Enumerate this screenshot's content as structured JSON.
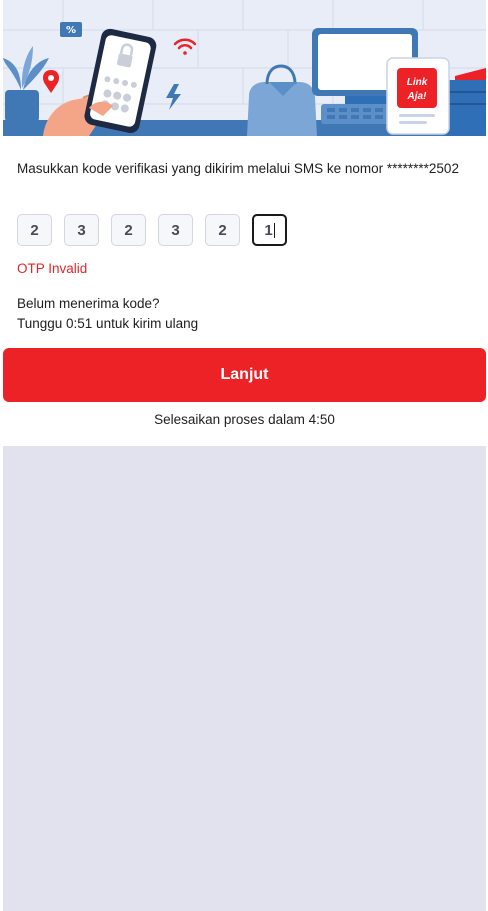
{
  "banner": {
    "logo_line1": "Link",
    "logo_line2": "Aja!",
    "colors": {
      "background": "#e8edf7",
      "brand_red": "#ec2227",
      "accent_blue": "#2f6fb8"
    },
    "icons": [
      "smartphone-lock-icon",
      "wifi-icon",
      "lightning-icon",
      "location-pin-icon",
      "discount-tag-icon",
      "plant-icon",
      "shopping-bag-icon",
      "monitor-icon",
      "cash-register-icon"
    ]
  },
  "otp_form": {
    "instruction": "Masukkan kode verifikasi yang dikirim melalui SMS ke nomor ********2502",
    "digits": [
      "2",
      "3",
      "2",
      "3",
      "2",
      "1"
    ],
    "active_index": 5,
    "error": "OTP Invalid",
    "resend_question": "Belum menerima kode?",
    "resend_countdown": "Tunggu 0:51 untuk kirim ulang",
    "submit_label": "Lanjut",
    "session_timer": "Selesaikan proses dalam 4:50"
  },
  "colors": {
    "primary": "#ec2227",
    "error": "#e3262b",
    "filler": "#e1e2ee"
  }
}
